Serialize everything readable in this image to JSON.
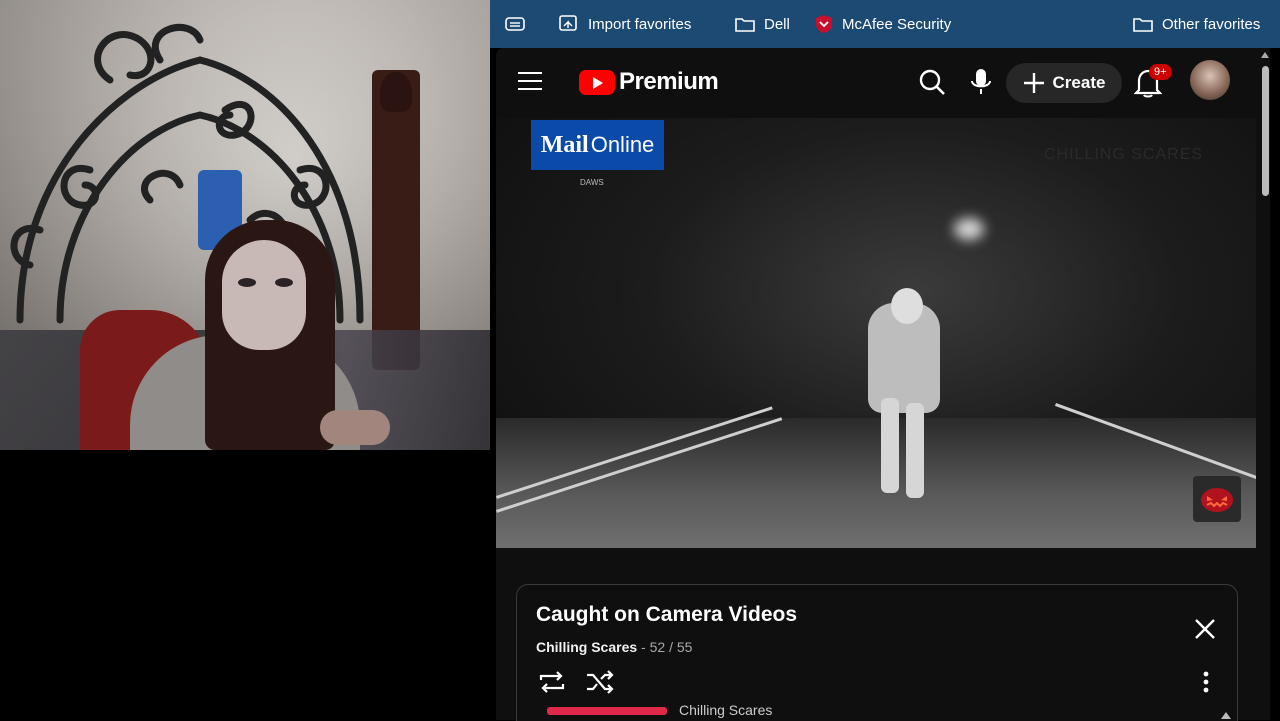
{
  "favorites": {
    "items": [
      {
        "label": "Import favorites",
        "icon": "import-icon"
      },
      {
        "label": "Dell",
        "icon": "folder-icon"
      },
      {
        "label": "McAfee Security",
        "icon": "mcafee-icon"
      },
      {
        "label": "Other favorites",
        "icon": "folder-icon"
      }
    ]
  },
  "youtube": {
    "logo_text": "Premium",
    "create_label": "Create",
    "notification_badge": "9+",
    "video": {
      "overlay_logo_main": "Mail",
      "overlay_logo_secondary": "Online",
      "overlay_logo_sub": "DAWS",
      "watermark": "CHILLING SCARES"
    },
    "playlist": {
      "title": "Caught on Camera Videos",
      "channel": "Chilling Scares",
      "separator": " - ",
      "position": "52 / 55",
      "next_item_channel": "Chilling Scares"
    }
  },
  "colors": {
    "favbar_bg": "#1d4a73",
    "youtube_red": "#ff0000",
    "yt_bg": "#0f0f0f"
  }
}
